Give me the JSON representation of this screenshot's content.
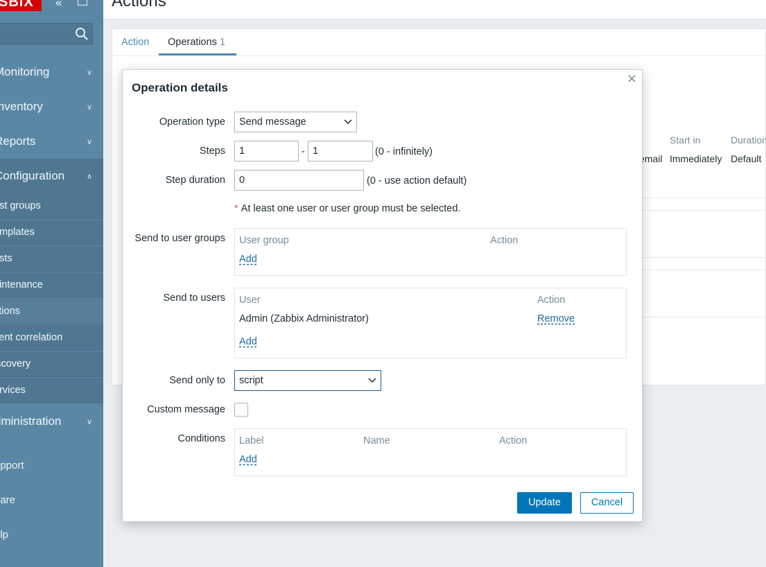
{
  "sidebar": {
    "logo_text": "SBIX",
    "search_placeholder": "",
    "sections": [
      {
        "label": "Monitoring",
        "chevron": "⌄"
      },
      {
        "label": "Inventory",
        "chevron": "⌄"
      },
      {
        "label": "Reports",
        "chevron": "⌄"
      },
      {
        "label": "Configuration",
        "chevron": "⌃"
      }
    ],
    "config_items": [
      "ost groups",
      "emplates",
      "osts",
      "aintenance",
      "ctions",
      "vent correlation",
      "iscovery",
      "ervices"
    ],
    "admin_section": {
      "label": "dministration",
      "chevron": "⌄"
    },
    "footer": [
      "upport",
      "hare",
      "elp"
    ]
  },
  "page": {
    "title": "Actions",
    "tabs": [
      {
        "label": "Action"
      },
      {
        "label": "Operations",
        "count": "1"
      }
    ],
    "background_table": {
      "headers": [
        "Start in",
        "Duration"
      ],
      "row": [
        "email",
        "Immediately",
        "Default"
      ]
    }
  },
  "modal": {
    "title": "Operation details",
    "close": "×",
    "operation_type": {
      "label": "Operation type",
      "value": "Send message"
    },
    "steps": {
      "label": "Steps",
      "from": "1",
      "separator": "-",
      "to": "1",
      "hint": "(0 - infinitely)"
    },
    "step_duration": {
      "label": "Step duration",
      "value": "0",
      "hint": "(0 - use action default)"
    },
    "required_note": "At least one user or user group must be selected.",
    "user_groups": {
      "label": "Send to user groups",
      "headers": [
        "User group",
        "Action"
      ],
      "add": "Add"
    },
    "users": {
      "label": "Send to users",
      "headers": [
        "User",
        "Action"
      ],
      "rows": [
        {
          "user": "Admin (Zabbix Administrator)",
          "action": "Remove"
        }
      ],
      "add": "Add"
    },
    "send_only_to": {
      "label": "Send only to",
      "value": "script"
    },
    "custom_message": {
      "label": "Custom message",
      "checked": false
    },
    "conditions": {
      "label": "Conditions",
      "headers": [
        "Label",
        "Name",
        "Action"
      ],
      "add": "Add"
    },
    "buttons": {
      "update": "Update",
      "cancel": "Cancel"
    }
  },
  "colors": {
    "sidebar": "#5b87a6",
    "primary": "#0275b8",
    "brand": "#d40000"
  }
}
